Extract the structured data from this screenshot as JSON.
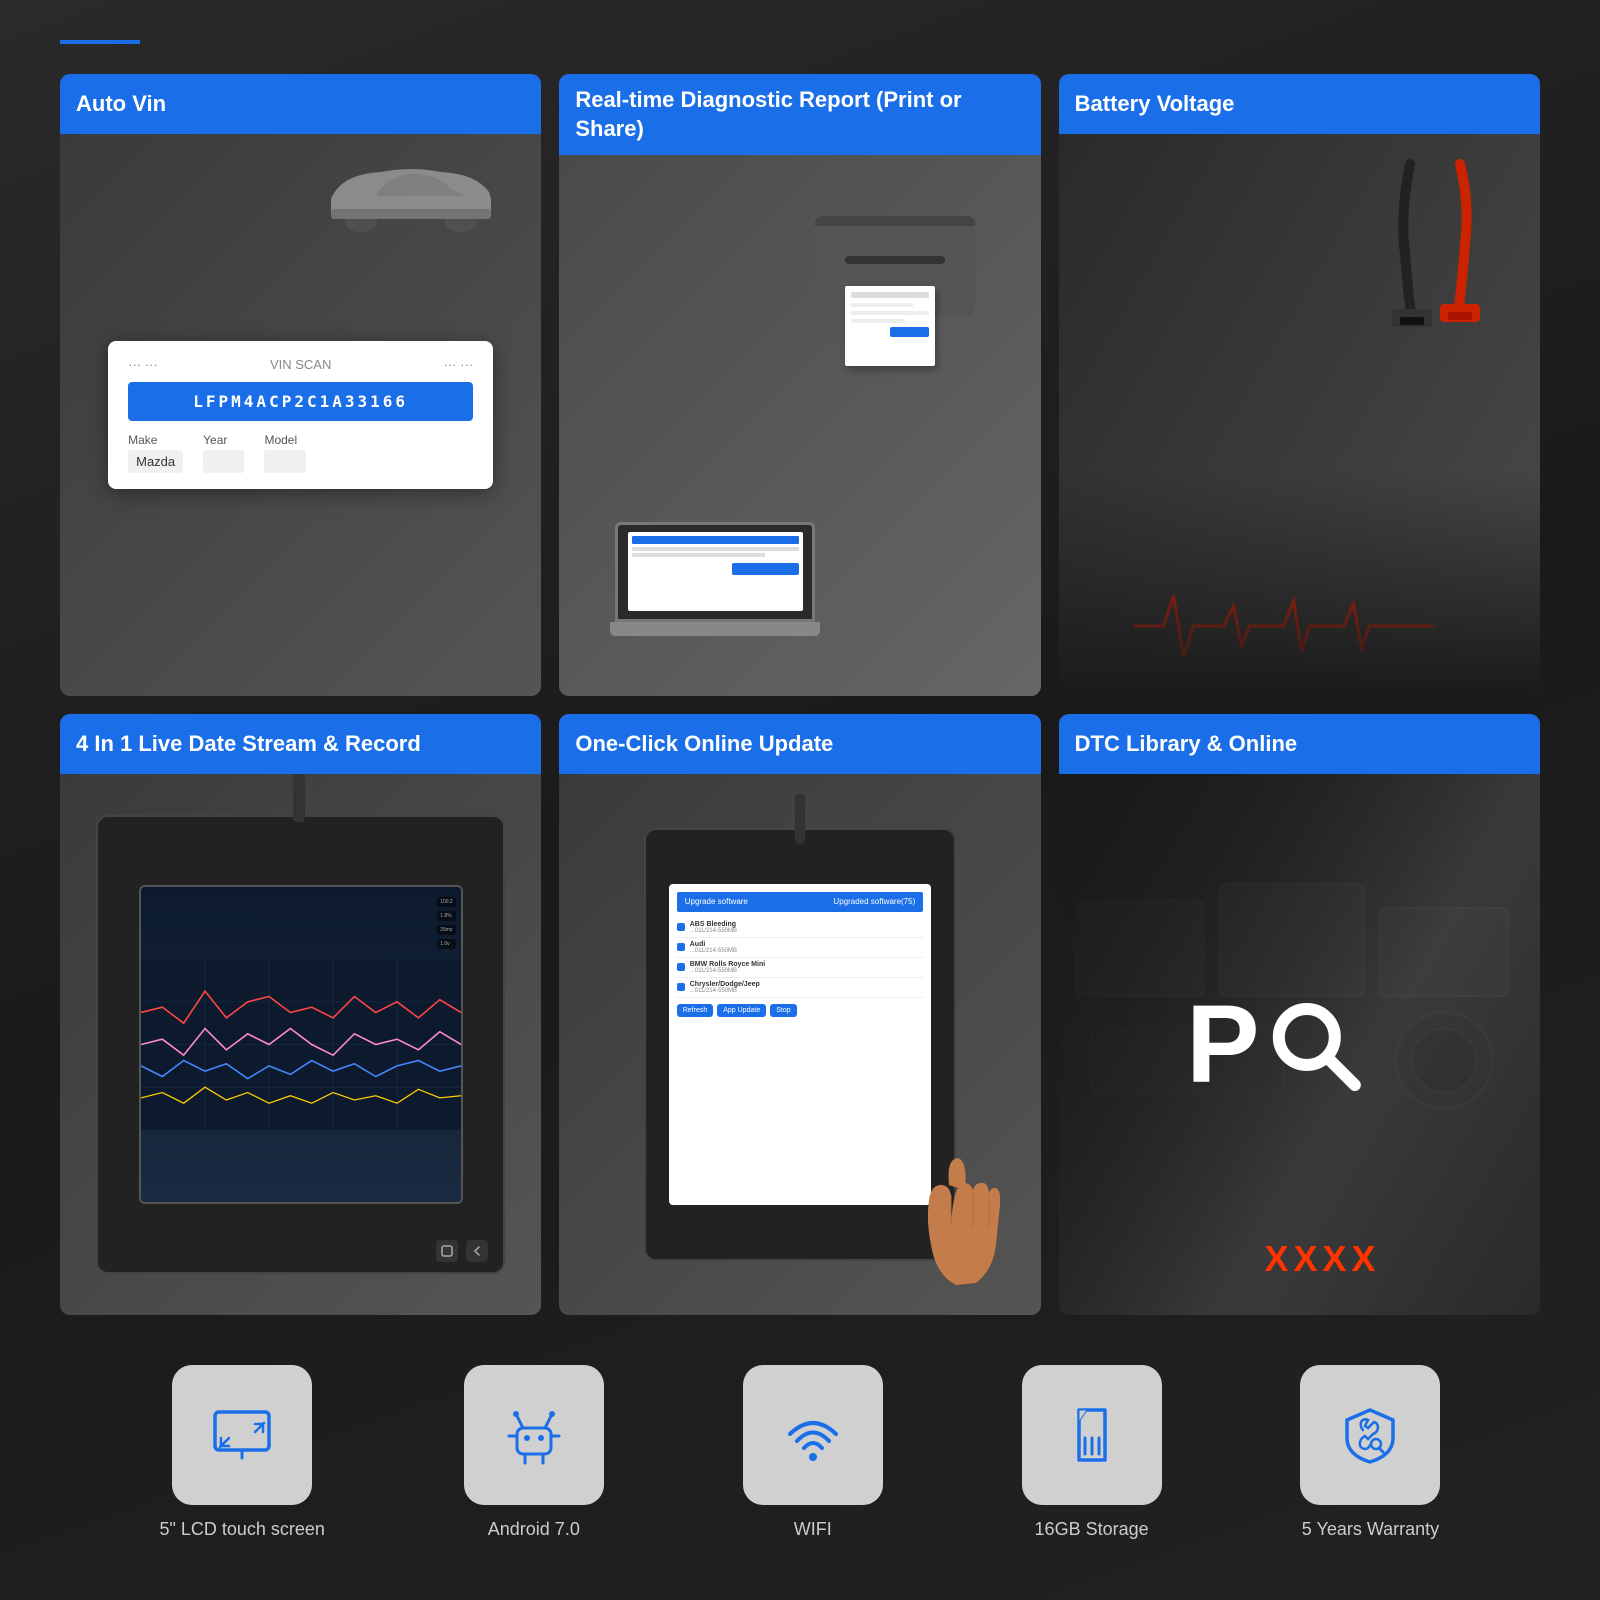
{
  "page": {
    "background_color": "#1a1a1a",
    "accent_color": "#1a6fe8"
  },
  "features_top": [
    {
      "id": "auto-vin",
      "label": "Auto Vin",
      "vin_scan_title": "VIN SCAN",
      "vin_number": "LFPM4ACP2C1A33166",
      "field_make_label": "Make",
      "field_make_value": "Mazda",
      "field_year_label": "Year",
      "field_model_label": "Model"
    },
    {
      "id": "diagnostic-report",
      "label": "Real-time Diagnostic Report (Print or Share)"
    },
    {
      "id": "battery-voltage",
      "label": "Battery Voltage"
    }
  ],
  "features_bottom": [
    {
      "id": "live-stream",
      "label": "4 In 1 Live Date Stream & Record"
    },
    {
      "id": "one-click-update",
      "label": "One-Click Online Update",
      "screen_header": "Upgrade software",
      "screen_header_right": "Upgraded software(75)",
      "items": [
        {
          "name": "ABS Bleeding",
          "detail": "...011/214-550MB"
        },
        {
          "name": "Audi",
          "detail": "...011/214-550MB"
        },
        {
          "name": "BMW Rolls Royce Mini",
          "detail": "...011/214-550MB"
        },
        {
          "name": "Chrysler/Dodge/Jeep",
          "detail": "...011/214-550MB"
        }
      ],
      "btn_refresh": "Refresh",
      "btn_app_update": "App Update",
      "btn_stop": "Stop"
    },
    {
      "id": "dtc-library",
      "label": "DTC Library & Online",
      "dtc_letter": "P",
      "dtc_xxxx": "XXXX"
    }
  ],
  "bottom_icons": [
    {
      "id": "lcd-screen",
      "label": "5\" LCD touch screen",
      "icon": "lcd"
    },
    {
      "id": "android",
      "label": "Android 7.0",
      "icon": "android"
    },
    {
      "id": "wifi",
      "label": "WIFI",
      "icon": "wifi"
    },
    {
      "id": "storage",
      "label": "16GB Storage",
      "icon": "storage"
    },
    {
      "id": "warranty",
      "label": "5 Years Warranty",
      "icon": "warranty"
    }
  ]
}
